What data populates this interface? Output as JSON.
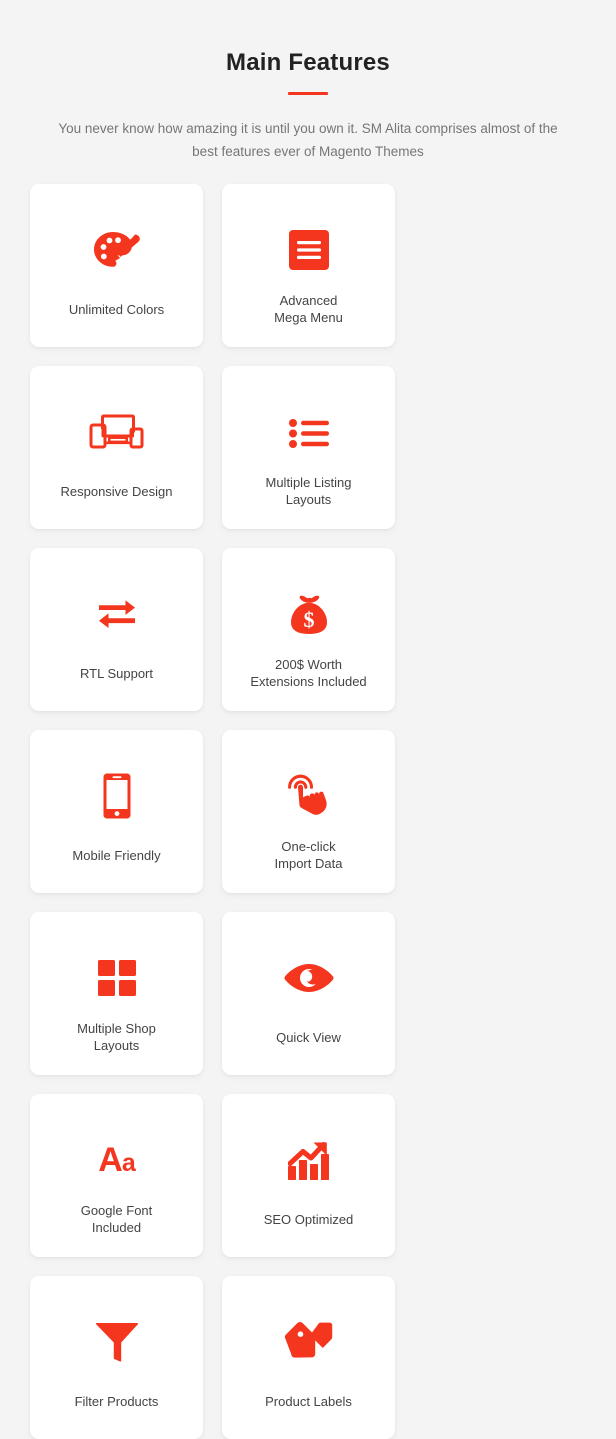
{
  "header": {
    "title": "Main Features",
    "subtitle": "You never know how amazing it is until you own it. SM Alita comprises almost of the best features ever of Magento Themes",
    "divider": "red-underline"
  },
  "theme": {
    "accent": "#f4361f",
    "background": "#f4f4f4",
    "card_background": "#ffffff",
    "title_color": "#222222",
    "subtitle_color": "#767676",
    "label_color": "#444444"
  },
  "features": [
    {
      "label": "Unlimited Colors",
      "icon": "palette-icon",
      "lines": 1
    },
    {
      "label": "Advanced\nMega Menu",
      "icon": "mega-menu-icon",
      "lines": 2
    },
    {
      "label": "Responsive Design",
      "icon": "responsive-devices-icon",
      "lines": 1
    },
    {
      "label": "Multiple Listing\nLayouts",
      "icon": "bullet-list-icon",
      "lines": 2
    },
    {
      "label": "RTL Support",
      "icon": "exchange-arrows-icon",
      "lines": 1
    },
    {
      "label": "200$ Worth\nExtensions Included",
      "icon": "money-bag-icon",
      "lines": 2
    },
    {
      "label": "Mobile Friendly",
      "icon": "mobile-phone-icon",
      "lines": 1
    },
    {
      "label": "One-click\nImport Data",
      "icon": "click-hand-icon",
      "lines": 2
    },
    {
      "label": "Multiple Shop\nLayouts",
      "icon": "grid-squares-icon",
      "lines": 2
    },
    {
      "label": "Quick View",
      "icon": "eye-icon",
      "lines": 1
    },
    {
      "label": "Google Font\nIncluded",
      "icon": "typography-aa-icon",
      "lines": 2
    },
    {
      "label": "SEO Optimized",
      "icon": "growth-chart-icon",
      "lines": 1
    },
    {
      "label": "Filter Products",
      "icon": "funnel-filter-icon",
      "lines": 1
    },
    {
      "label": "Product Labels",
      "icon": "price-tags-icon",
      "lines": 1
    }
  ]
}
